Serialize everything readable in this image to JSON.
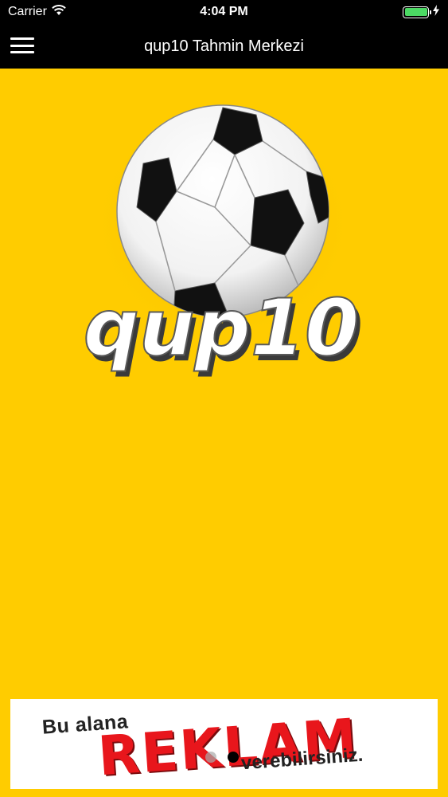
{
  "status_bar": {
    "carrier": "Carrier",
    "time": "4:04 PM",
    "icons": [
      "wifi-icon",
      "battery-icon",
      "charging-icon"
    ]
  },
  "nav": {
    "title": "qup10 Tahmin Merkezi",
    "menu_icon": "hamburger-menu-icon"
  },
  "logo": {
    "text": "qup10",
    "image": "soccer-ball"
  },
  "ad": {
    "line1": "Bu alana",
    "line2": "REKLAM",
    "line3": "verebilirsiniz."
  },
  "pager": {
    "count": 2,
    "active_index": 1
  },
  "colors": {
    "background": "#ffcc00",
    "bars": "#000000",
    "ad_red": "#e8161c",
    "battery": "#4cd964"
  }
}
